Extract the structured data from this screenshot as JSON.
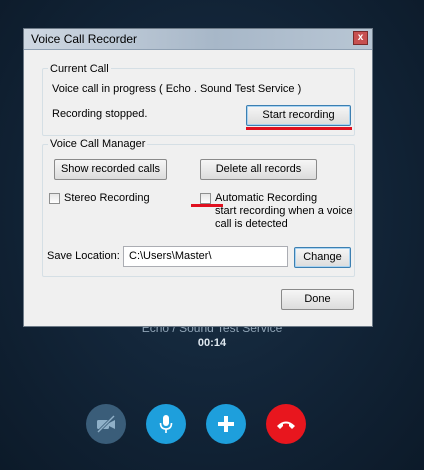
{
  "background": {
    "call_title": "Echo / Sound Test Service",
    "timer": "00:14"
  },
  "call_controls": {
    "video_icon": "video-off-icon",
    "mic_icon": "microphone-icon",
    "add_icon": "plus-icon",
    "hangup_icon": "hang-up-icon",
    "colors": {
      "accent": "#1e9fdc",
      "hangup": "#e8161e",
      "video_off": "#3a5d79"
    }
  },
  "window": {
    "title": "Voice Call Recorder",
    "close_label": "x"
  },
  "current_call": {
    "label": "Current Call",
    "status": "Voice call in progress ( Echo . Sound Test Service )",
    "recording_status": "Recording stopped.",
    "start_button": "Start recording"
  },
  "manager": {
    "label": "Voice Call Manager",
    "show_button": "Show recorded calls",
    "delete_button": "Delete all records",
    "stereo_label": "Stereo Recording",
    "stereo_checked": false,
    "auto_label": "Automatic Recording",
    "auto_desc_1": "start recording when a voice",
    "auto_desc_2": "call is detected",
    "auto_checked": false,
    "save_location_label": "Save Location:",
    "save_location_value": "C:\\Users\\Master\\",
    "change_button": "Change"
  },
  "done_button": "Done"
}
